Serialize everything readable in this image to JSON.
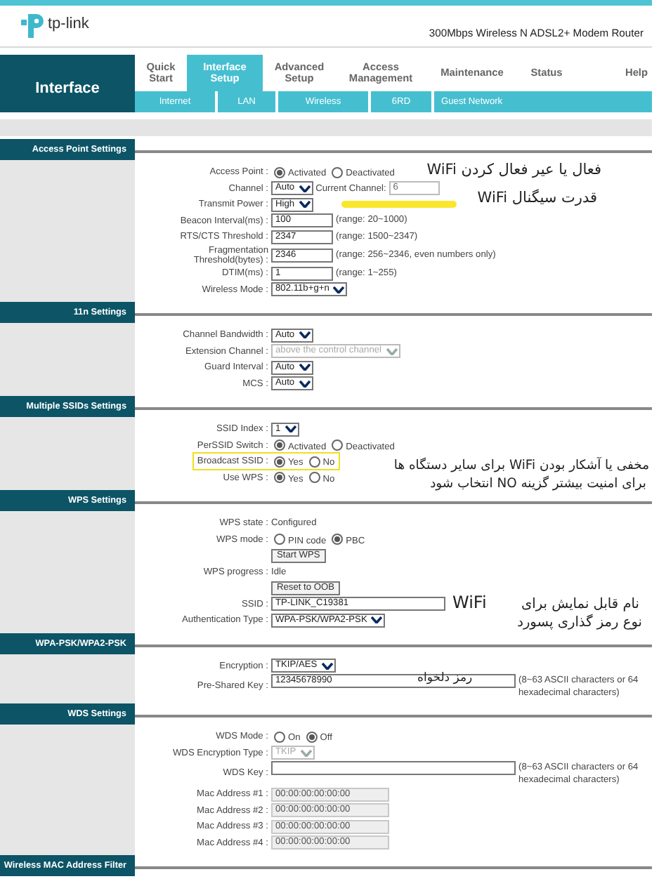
{
  "header": {
    "brand": "tp-link",
    "product": "300Mbps Wireless N ADSL2+ Modem Router"
  },
  "nav": {
    "heading": "Interface",
    "tabs": [
      {
        "label": "Quick Start",
        "selected": false
      },
      {
        "label": "Interface Setup",
        "selected": true
      },
      {
        "label": "Advanced Setup",
        "selected": false
      },
      {
        "label": "Access Management",
        "selected": false
      },
      {
        "label": "Maintenance",
        "selected": false
      },
      {
        "label": "Status",
        "selected": false
      },
      {
        "label": "Help",
        "selected": false
      }
    ],
    "subtabs": [
      "Internet",
      "LAN",
      "Wireless",
      "6RD",
      "Guest Network"
    ]
  },
  "sections": [
    {
      "title": "Access Point Settings",
      "rows": [
        {
          "kind": "radio",
          "label": "Access Point :",
          "options": [
            {
              "label": "Activated",
              "selected": true
            },
            {
              "label": "Deactivated",
              "selected": false
            }
          ]
        },
        {
          "kind": "select",
          "label": "Channel :",
          "value": "Auto",
          "readout": {
            "label": "Current Channel:",
            "value": "6"
          }
        },
        {
          "kind": "select",
          "label": "Transmit Power :",
          "value": "High",
          "marked": true
        },
        {
          "kind": "input",
          "label": "Beacon Interval(ms) :",
          "value": "100",
          "hint": "(range: 20~1000)"
        },
        {
          "kind": "input",
          "label": "RTS/CTS Threshold :",
          "value": "2347",
          "hint": "(range: 1500~2347)"
        },
        {
          "kind": "input",
          "label": "Fragmentation Threshold(bytes) :",
          "value": "2346",
          "hint": "(range: 256~2346, even numbers only)"
        },
        {
          "kind": "input",
          "label": "DTIM(ms) :",
          "value": "1",
          "hint": "(range: 1~255)"
        },
        {
          "kind": "select",
          "label": "Wireless Mode :",
          "value": "802.11b+g+n"
        }
      ]
    },
    {
      "title": "11n Settings",
      "rows": [
        {
          "kind": "select",
          "label": "Channel Bandwidth :",
          "value": "Auto"
        },
        {
          "kind": "select",
          "label": "Extension Channel :",
          "value": "above the control channel",
          "disabled": true
        },
        {
          "kind": "select",
          "label": "Guard Interval :",
          "value": "Auto"
        },
        {
          "kind": "select",
          "label": "MCS :",
          "value": "Auto"
        }
      ]
    },
    {
      "title": "Multiple SSIDs Settings",
      "rows": [
        {
          "kind": "select",
          "label": "SSID Index :",
          "value": "1"
        },
        {
          "kind": "radio",
          "label": "PerSSID Switch :",
          "options": [
            {
              "label": "Activated",
              "selected": true
            },
            {
              "label": "Deactivated",
              "selected": false
            }
          ]
        },
        {
          "kind": "radio",
          "label": "Broadcast SSID :",
          "highlighted": true,
          "options": [
            {
              "label": "Yes",
              "selected": true
            },
            {
              "label": "No",
              "selected": false
            }
          ]
        },
        {
          "kind": "radio",
          "label": "Use WPS :",
          "options": [
            {
              "label": "Yes",
              "selected": true
            },
            {
              "label": "No",
              "selected": false
            }
          ]
        }
      ]
    },
    {
      "title": "WPS Settings",
      "rows": [
        {
          "kind": "text",
          "label": "WPS state :",
          "value": "Configured"
        },
        {
          "kind": "radio",
          "label": "WPS mode :",
          "options": [
            {
              "label": "PIN code",
              "selected": false
            },
            {
              "label": "PBC",
              "selected": true
            }
          ]
        },
        {
          "kind": "button",
          "value": "Start WPS"
        },
        {
          "kind": "text",
          "label": "WPS progress :",
          "value": "Idle"
        },
        {
          "kind": "button",
          "value": "Reset to OOB"
        },
        {
          "kind": "input",
          "label": "SSID :",
          "value": "TP-LINK_C19381"
        },
        {
          "kind": "select",
          "label": "Authentication Type :",
          "value": "WPA-PSK/WPA2-PSK"
        }
      ]
    },
    {
      "title": "WPA-PSK/WPA2-PSK",
      "rows": [
        {
          "kind": "select",
          "label": "Encryption :",
          "value": "TKIP/AES"
        },
        {
          "kind": "input",
          "label": "Pre-Shared Key :",
          "value": "12345678990",
          "hint": "(8~63 ASCII characters or 64 hexadecimal characters)"
        }
      ]
    },
    {
      "title": "WDS Settings",
      "rows": [
        {
          "kind": "radio",
          "label": "WDS Mode :",
          "options": [
            {
              "label": "On",
              "selected": false
            },
            {
              "label": "Off",
              "selected": true
            }
          ]
        },
        {
          "kind": "select",
          "label": "WDS Encryption Type :",
          "value": "TKIP",
          "disabled": true
        },
        {
          "kind": "input",
          "label": "WDS Key :",
          "hint": "(8~63 ASCII characters or 64 hexadecimal characters)"
        },
        {
          "kind": "input",
          "label": "Mac Address #1 :",
          "value": "00:00:00:00:00:00",
          "disabled": true
        },
        {
          "kind": "input",
          "label": "Mac Address #2 :",
          "value": "00:00:00:00:00:00",
          "disabled": true
        },
        {
          "kind": "input",
          "label": "Mac Address #3 :",
          "value": "00:00:00:00:00:00",
          "disabled": true
        },
        {
          "kind": "input",
          "label": "Mac Address #4 :",
          "value": "00:00:00:00:00:00",
          "disabled": true
        }
      ]
    },
    {
      "title": "Wireless MAC Address Filter"
    }
  ],
  "annotations": [
    "فعال یا عیر فعال کردن WiFi",
    "قدرت سیگنال WiFi",
    "مخفی یا آشکار بودن WiFi برای سایر دستگاه ها",
    "برای امنیت بیشتر گزینه NO انتخاب شود",
    "WiFi",
    "نام قابل نمایش برای",
    "نوع رمز گذاری پسورد",
    "رمز دلخواه"
  ]
}
